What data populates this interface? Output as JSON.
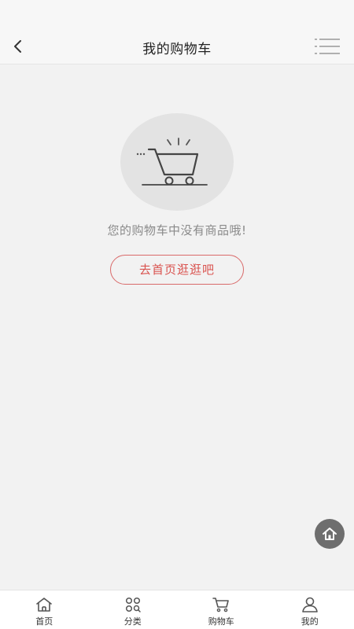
{
  "header": {
    "title": "我的购物车",
    "back_icon": "chevron-left-icon",
    "menu_icon": "list-menu-icon"
  },
  "empty_state": {
    "icon": "shopping-cart-icon",
    "message": "您的购物车中没有商品哦!",
    "button_label": "去首页逛逛吧"
  },
  "floating": {
    "icon": "home-icon"
  },
  "tabbar": {
    "items": [
      {
        "label": "首页",
        "icon": "home-icon"
      },
      {
        "label": "分类",
        "icon": "category-icon"
      },
      {
        "label": "购物车",
        "icon": "cart-icon"
      },
      {
        "label": "我的",
        "icon": "user-icon"
      }
    ]
  },
  "colors": {
    "accent": "#d9534f",
    "background": "#f2f2f2",
    "header_bg": "#f7f7f7"
  }
}
